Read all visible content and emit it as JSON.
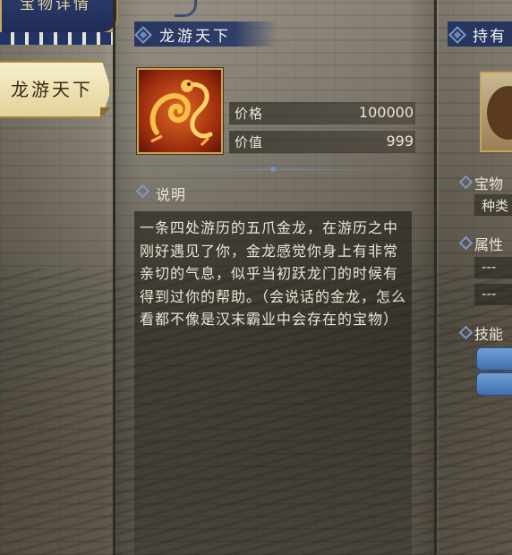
{
  "left_nav": {
    "banner_title": "宝物详情",
    "tab_label": "龙游天下"
  },
  "item": {
    "name": "龙游天下",
    "icon": "golden-dragon-icon",
    "price_label": "价格",
    "price_value": "100000",
    "worth_label": "价值",
    "worth_value": "999"
  },
  "description": {
    "heading": "说明",
    "text": "一条四处游历的五爪金龙，在游历之中刚好遇见了你，金龙感觉你身上有非常亲切的气息，似乎当初跃龙门的时候有得到过你的帮助。（会说话的金龙，怎么看都不像是汉末霸业中会存在的宝物）"
  },
  "right_panel": {
    "title": "持有",
    "type_heading": "宝物",
    "type_value": "种类",
    "attr_heading": "属性",
    "attr_values": [
      "---",
      "---"
    ],
    "skill_heading": "技能"
  },
  "colors": {
    "accent_blue": "#27365e",
    "gold_border": "#c7a35a",
    "text_light": "#ece6d4"
  }
}
